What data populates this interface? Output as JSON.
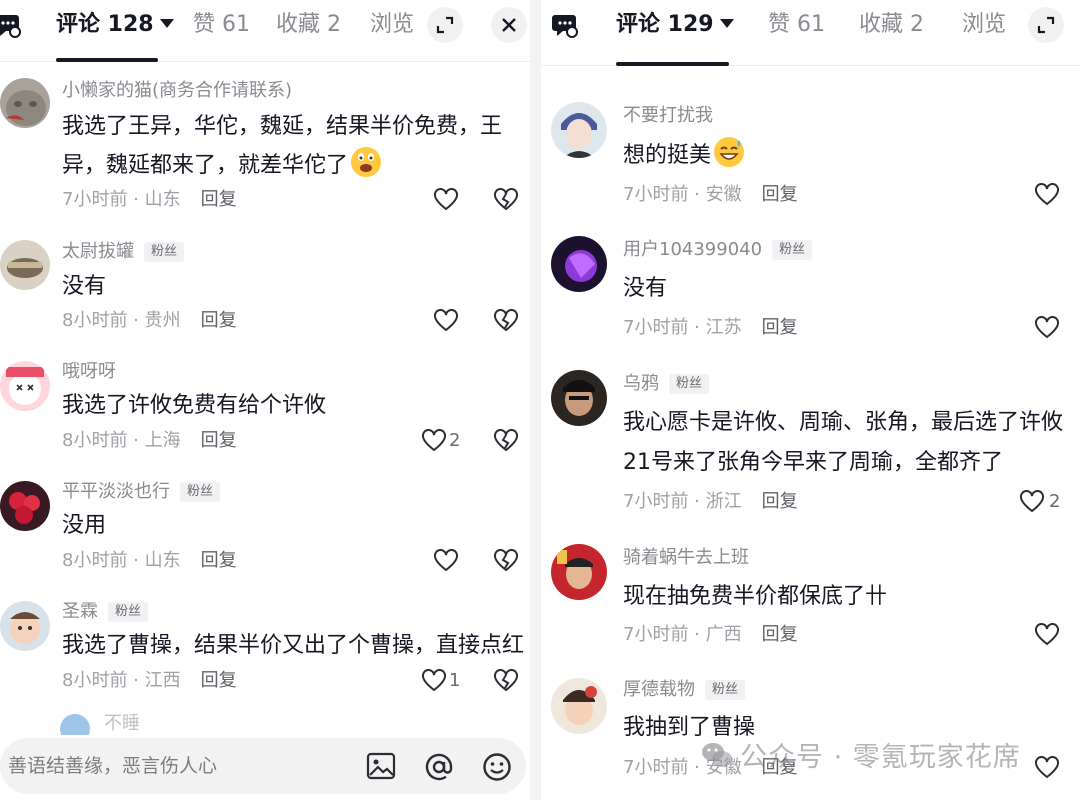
{
  "left": {
    "tabs": {
      "comments": "评论 128",
      "likes": "赞 61",
      "favorites": "收藏 2",
      "views": "浏览"
    },
    "comments": [
      {
        "user": "小懒家的猫(商务合作请联系)",
        "badge": "",
        "text_lines": [
          "我选了王异，华佗，魏延，结果半价免费，王",
          "异，魏延都来了，就差华佗了"
        ],
        "time_loc": "7小时前 · 山东",
        "reply": "回复",
        "like_count": ""
      },
      {
        "user": "太尉拔罐",
        "badge": "粉丝",
        "text_lines": [
          "没有"
        ],
        "time_loc": "8小时前 · 贵州",
        "reply": "回复",
        "like_count": ""
      },
      {
        "user": "哦呀呀",
        "badge": "",
        "text_lines": [
          "我选了许攸免费有给个许攸"
        ],
        "time_loc": "8小时前 · 上海",
        "reply": "回复",
        "like_count": "2"
      },
      {
        "user": "平平淡淡也行",
        "badge": "粉丝",
        "text_lines": [
          "没用"
        ],
        "time_loc": "8小时前 · 山东",
        "reply": "回复",
        "like_count": ""
      },
      {
        "user": "圣霖",
        "badge": "粉丝",
        "text_lines": [
          "我选了曹操，结果半价又出了个曹操，直接点红"
        ],
        "time_loc": "8小时前 · 江西",
        "reply": "回复",
        "like_count": "1"
      }
    ],
    "partial_user": "不睡",
    "input": {
      "placeholder": "善语结善缘，恶言伤人心",
      "value": ""
    }
  },
  "right": {
    "tabs": {
      "comments": "评论 129",
      "likes": "赞 61",
      "favorites": "收藏 2",
      "views": "浏览"
    },
    "comments": [
      {
        "user": "不要打扰我",
        "badge": "",
        "text_lines": [
          "想的挺美"
        ],
        "time_loc": "7小时前 · 安徽",
        "reply": "回复",
        "like_count": ""
      },
      {
        "user": "用户104399040",
        "badge": "粉丝",
        "text_lines": [
          "没有"
        ],
        "time_loc": "7小时前 · 江苏",
        "reply": "回复",
        "like_count": ""
      },
      {
        "user": "乌鸦",
        "badge": "粉丝",
        "text_lines": [
          "我心愿卡是许攸、周瑜、张角，最后选了许攸",
          "21号来了张角今早来了周瑜，全都齐了"
        ],
        "time_loc": "7小时前 · 浙江",
        "reply": "回复",
        "like_count": "2"
      },
      {
        "user": "骑着蜗牛去上班",
        "badge": "",
        "text_lines": [
          "现在抽免费半价都保底了卄"
        ],
        "time_loc": "7小时前 · 广西",
        "reply": "回复",
        "like_count": ""
      },
      {
        "user": "厚德载物",
        "badge": "粉丝",
        "text_lines": [
          "我抽到了曹操"
        ],
        "time_loc": "7小时前 · 安徽",
        "reply": "回复",
        "like_count": ""
      }
    ]
  },
  "watermark": "公众号 · 零氪玩家花席",
  "icons": [
    "chat-icon",
    "caret-down-icon",
    "expand-icon",
    "close-icon",
    "heart-icon",
    "broken-heart-icon",
    "image-icon",
    "at-icon",
    "emoji-icon",
    "grimace-emoji-icon",
    "grin-sweat-emoji-icon",
    "wechat-icon"
  ]
}
